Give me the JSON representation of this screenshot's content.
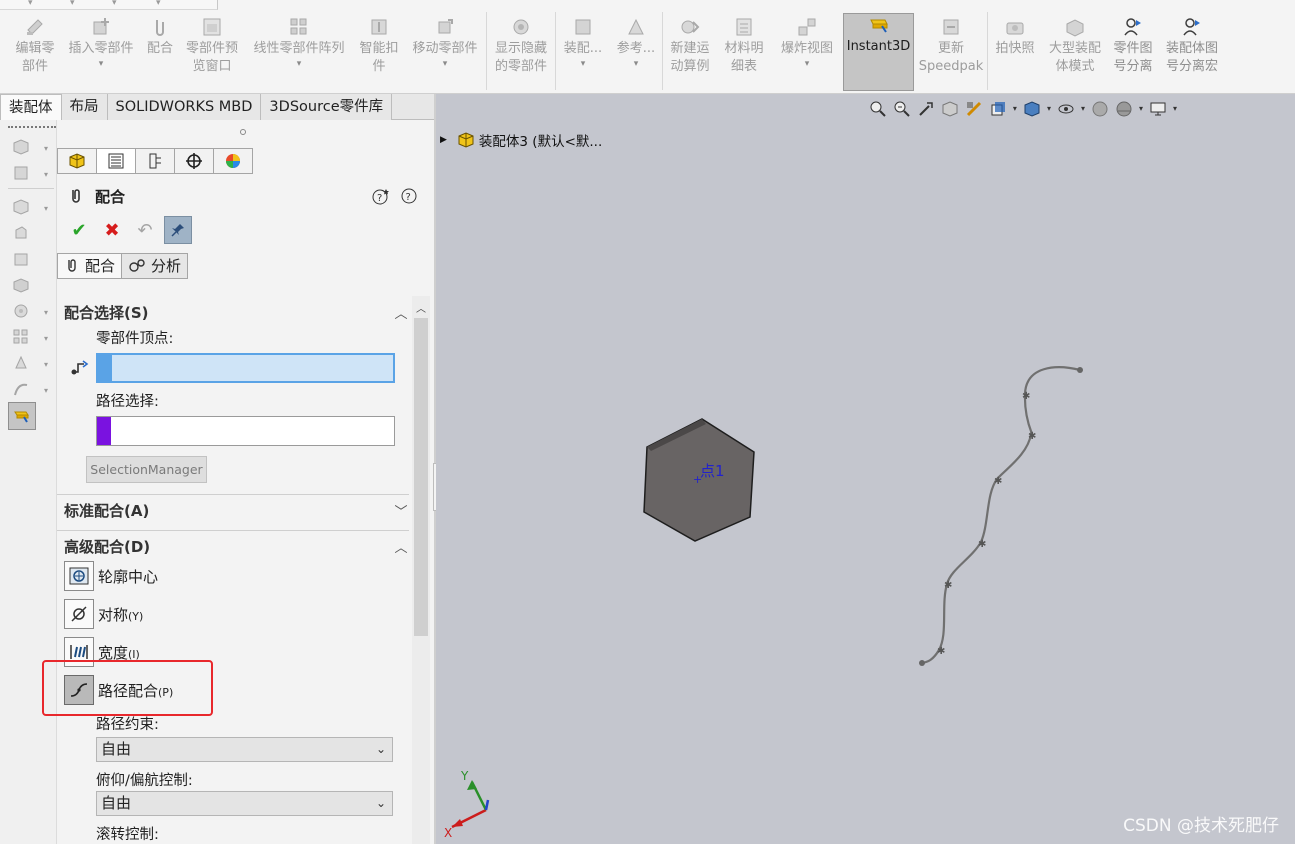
{
  "ribbon": {
    "buttons": [
      {
        "label": "编辑零\n部件",
        "icon": "edit-component-icon"
      },
      {
        "label": "插入零部件",
        "icon": "insert-component-icon"
      },
      {
        "label": "配合",
        "icon": "mate-icon"
      },
      {
        "label": "零部件预\n览窗口",
        "icon": "preview-window-icon"
      },
      {
        "label": "线性零部件阵列",
        "icon": "linear-pattern-icon"
      },
      {
        "label": "智能扣\n件",
        "icon": "smart-fastener-icon"
      },
      {
        "label": "移动零部件",
        "icon": "move-component-icon"
      },
      {
        "label": "显示隐藏\n的零部件",
        "icon": "show-hidden-icon"
      },
      {
        "label": "装配...",
        "icon": "assembly-feature-icon"
      },
      {
        "label": "参考...",
        "icon": "reference-geometry-icon"
      },
      {
        "label": "新建运\n动算例",
        "icon": "motion-study-icon"
      },
      {
        "label": "材料明\n细表",
        "icon": "bom-icon"
      },
      {
        "label": "爆炸视图",
        "icon": "exploded-view-icon"
      },
      {
        "label": "Instant3D",
        "icon": "instant3d-icon"
      },
      {
        "label": "更新\nSpeedpak",
        "icon": "speedpak-icon"
      },
      {
        "label": "拍快照",
        "icon": "snapshot-icon"
      },
      {
        "label": "大型装配\n体模式",
        "icon": "large-assembly-icon"
      },
      {
        "label": "零件图\n号分离",
        "icon": "part-number-split-icon"
      },
      {
        "label": "装配体图\n号分离宏",
        "icon": "assembly-number-macro-icon"
      }
    ]
  },
  "tabs": [
    "装配体",
    "布局",
    "SOLIDWORKS MBD",
    "3DSource零件库"
  ],
  "pm": {
    "title": "配合",
    "subtabs": [
      "配合",
      "分析"
    ],
    "group_mate_selections": "配合选择(S)",
    "label_vertex": "零部件顶点:",
    "label_path": "路径选择:",
    "selection_manager": "SelectionManager",
    "group_standard": "标准配合(A)",
    "group_advanced": "高级配合(D)",
    "advanced_mates": [
      {
        "label": "轮廓中心",
        "key": ""
      },
      {
        "label": "对称",
        "key": "(Y)"
      },
      {
        "label": "宽度",
        "key": "(I)"
      },
      {
        "label": "路径配合",
        "key": "(P)"
      }
    ],
    "label_path_constraint": "路径约束:",
    "path_constraint_value": "自由",
    "label_pitch_yaw": "俯仰/偏航控制:",
    "pitch_yaw_value": "自由",
    "label_roll": "滚转控制:"
  },
  "graphics": {
    "tree_root": "装配体3  (默认<默...",
    "point_label": "点1",
    "axis_x": "X",
    "axis_y": "Y",
    "watermark": "CSDN @技术死肥仔"
  },
  "colors": {
    "accent": "#5aa3e6",
    "path_selection": "#7a12e0",
    "highlight": "#e8272c",
    "viewport": "#c4c6ce"
  }
}
